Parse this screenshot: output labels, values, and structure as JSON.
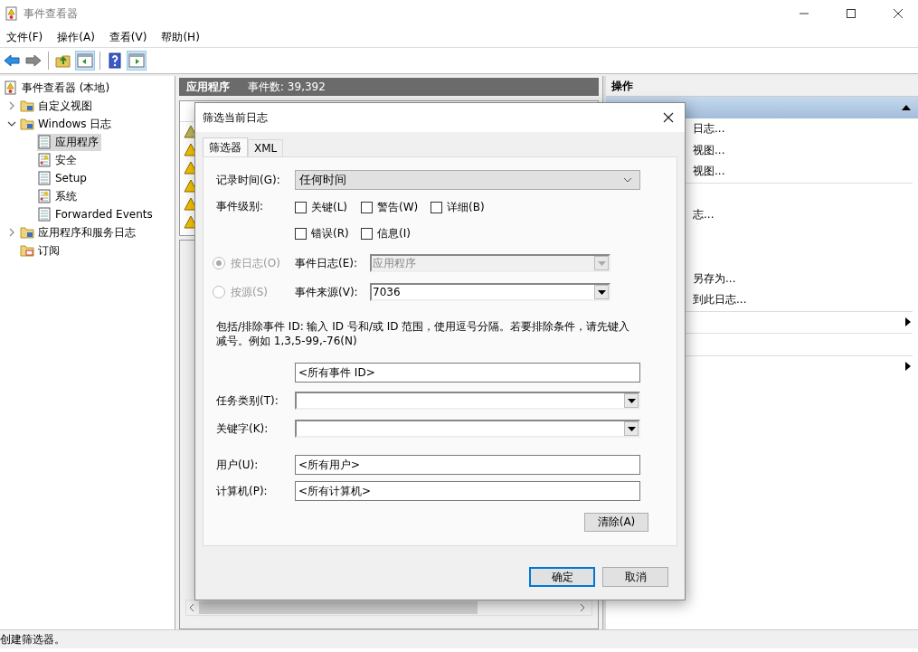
{
  "window": {
    "title": "事件查看器"
  },
  "menu": [
    "文件(F)",
    "操作(A)",
    "查看(V)",
    "帮助(H)"
  ],
  "toolbar": [
    {
      "kind": "back",
      "on": false
    },
    {
      "kind": "forward",
      "on": false
    },
    {
      "kind": "separator"
    },
    {
      "kind": "folder-up",
      "on": false
    },
    {
      "kind": "pane-left",
      "on": true
    },
    {
      "kind": "separator"
    },
    {
      "kind": "help",
      "on": false
    },
    {
      "kind": "pane-right",
      "on": true
    }
  ],
  "tree": [
    {
      "label": "事件查看器 (本地)",
      "kind": "root",
      "selected": false,
      "children": [
        {
          "label": "自定义视图",
          "kind": "folder",
          "selected": false,
          "expanded": false
        },
        {
          "label": "Windows 日志",
          "kind": "folder",
          "selected": false,
          "expanded": true,
          "children": [
            {
              "label": "应用程序",
              "kind": "log",
              "selected": true
            },
            {
              "label": "安全",
              "kind": "log-warn",
              "selected": false
            },
            {
              "label": "Setup",
              "kind": "log",
              "selected": false
            },
            {
              "label": "系统",
              "kind": "log-warn",
              "selected": false
            },
            {
              "label": "Forwarded Events",
              "kind": "log",
              "selected": false
            }
          ]
        },
        {
          "label": "应用程序和服务日志",
          "kind": "folder",
          "selected": false,
          "expanded": false
        },
        {
          "label": "订阅",
          "kind": "subscription",
          "selected": false
        }
      ]
    }
  ],
  "center": {
    "title": "应用程序",
    "count": "事件数: 39,392",
    "rows": [
      {
        "kind": "warning",
        "selected": true
      },
      {
        "kind": "warning",
        "selected": false
      },
      {
        "kind": "warning",
        "selected": false
      },
      {
        "kind": "warning",
        "selected": false
      },
      {
        "kind": "warning",
        "selected": false
      },
      {
        "kind": "warning",
        "selected": false
      }
    ]
  },
  "actions": {
    "title": "操作",
    "section_expanded": true,
    "items": [
      {
        "kind": "text",
        "label": "日志..."
      },
      {
        "kind": "text",
        "label": "视图..."
      },
      {
        "kind": "text",
        "label": "视图..."
      },
      {
        "kind": "separator"
      },
      {
        "kind": "blank"
      },
      {
        "kind": "text",
        "label": "志..."
      },
      {
        "kind": "blank"
      },
      {
        "kind": "blank"
      },
      {
        "kind": "text",
        "label": "另存为..."
      },
      {
        "kind": "text",
        "label": "到此日志..."
      },
      {
        "kind": "separator"
      },
      {
        "kind": "submenu"
      },
      {
        "kind": "separator"
      },
      {
        "kind": "blank"
      },
      {
        "kind": "separator"
      },
      {
        "kind": "submenu"
      }
    ]
  },
  "dialog": {
    "title": "筛选当前日志",
    "tabs": [
      {
        "label": "筛选器",
        "selected": true
      },
      {
        "label": "XML",
        "selected": false
      }
    ],
    "logged": {
      "label": "记录时间(G):",
      "value": "任何时间"
    },
    "level": {
      "label": "事件级别:",
      "options": [
        {
          "label": "关键(L)",
          "checked": false
        },
        {
          "label": "警告(W)",
          "checked": false
        },
        {
          "label": "详细(B)",
          "checked": false
        },
        {
          "label": "错误(R)",
          "checked": false
        },
        {
          "label": "信息(I)",
          "checked": false
        }
      ]
    },
    "scope": [
      {
        "label": "按日志(O)",
        "selected": true,
        "field_label": "事件日志(E):",
        "value": "应用程序",
        "field_disabled": true
      },
      {
        "label": "按源(S)",
        "selected": false,
        "field_label": "事件来源(V):",
        "value": "7036",
        "field_disabled": false
      }
    ],
    "hint": "包括/排除事件 ID: 输入 ID 号和/或 ID 范围，使用逗号分隔。若要排除条件，请先键入减号。例如 1,3,5-99,-76(N)",
    "event_ids": "<所有事件 ID>",
    "fields": [
      {
        "kind": "combo",
        "label": "任务类别(T):"
      },
      {
        "kind": "combo",
        "label": "关键字(K):"
      },
      {
        "kind": "text",
        "label": "用户(U):",
        "value": "<所有用户>"
      },
      {
        "kind": "text",
        "label": "计算机(P):",
        "value": "<所有计算机>"
      }
    ],
    "clear_button": "清除(A)",
    "buttons": [
      {
        "label": "确定",
        "default": true
      },
      {
        "label": "取消",
        "default": false
      }
    ]
  },
  "status_bar": "创建筛选器。"
}
